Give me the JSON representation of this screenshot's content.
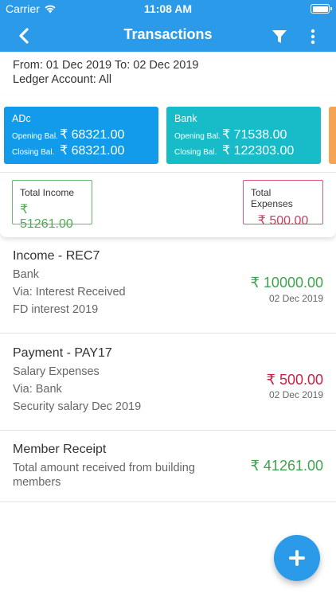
{
  "status_bar": {
    "carrier": "Carrier",
    "time": "11:08 AM"
  },
  "nav": {
    "title": "Transactions"
  },
  "period": {
    "range": "From: 01 Dec 2019 To: 02 Dec 2019",
    "ledger": "Ledger Account: All"
  },
  "accounts": [
    {
      "name": "ADc",
      "opening_label": "Opening Bal.",
      "opening": "₹ 68321.00",
      "closing_label": "Closing Bal.",
      "closing": "₹ 68321.00",
      "color": "#119bea"
    },
    {
      "name": "Bank",
      "opening_label": "Opening Bal.",
      "opening": "₹ 71538.00",
      "closing_label": "Closing Bal.",
      "closing": "₹ 122303.00",
      "color": "#17bcc8"
    }
  ],
  "totals": {
    "income_label": "Total Income",
    "income": "₹ 51261.00",
    "expense_label": "Total Expenses",
    "expense": "₹ 500.00"
  },
  "transactions": [
    {
      "title": "Income - REC7",
      "line1": "Bank",
      "line2": "Via: Interest Received",
      "line3": "FD interest 2019",
      "amount": "₹ 10000.00",
      "date": "02 Dec 2019",
      "type": "income"
    },
    {
      "title": "Payment - PAY17",
      "line1": "Salary Expenses",
      "line2": "Via: Bank",
      "line3": "Security salary Dec 2019",
      "amount": "₹ 500.00",
      "date": "02 Dec 2019",
      "type": "expense"
    },
    {
      "title": "Member Receipt",
      "line1": "Total amount received from building",
      "line2": "members",
      "amount": "₹ 41261.00",
      "type": "income"
    }
  ],
  "colors": {
    "primary": "#2b9be9",
    "income": "#3fa34d",
    "expense": "#cc1f43"
  }
}
